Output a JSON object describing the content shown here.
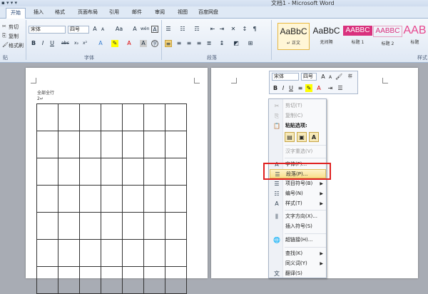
{
  "window": {
    "title": "文档1 - Microsoft Word",
    "qat": "▪ ▾ ▾ ▾"
  },
  "tabs": [
    "开始",
    "插入",
    "格式",
    "页面布局",
    "引用",
    "邮件",
    "审阅",
    "视图",
    "百度网盘"
  ],
  "clipboard": {
    "cut": "剪切",
    "copy": "复制",
    "format_painter": "格式刷",
    "group": "贴"
  },
  "font": {
    "name": "宋体",
    "size": "四号",
    "group": "字体",
    "grow": "A",
    "shrink": "A",
    "aa": "Aa",
    "clear": "A",
    "phonetic": "wén",
    "charbox": "A"
  },
  "paragraph": {
    "group": "段落"
  },
  "styles": [
    {
      "preview": "AaBbC",
      "label": "↵ 正文"
    },
    {
      "preview": "AaBbC",
      "label": "无间隔"
    },
    {
      "preview": "AABBC",
      "label": "标题 1"
    },
    {
      "preview": "AABBC",
      "label": "标题 2"
    },
    {
      "preview": "AAB",
      "label": "标题"
    }
  ],
  "styles_group": "样式",
  "document": {
    "first_line": "全部全行",
    "second_line": "2↵"
  },
  "mini_toolbar": {
    "font": "宋体",
    "size": "四号",
    "bold": "B",
    "italic": "I",
    "underline": "U",
    "grow": "A",
    "shrink": "A"
  },
  "context_menu": {
    "cut": "剪切(T)",
    "copy": "复制(C)",
    "paste_options": "粘贴选项:",
    "chinese_conversion": "汉字重选(V)",
    "font": "字体(F)...",
    "paragraph": "段落(P)...",
    "bullets": "项目符号(B)",
    "numbering": "编号(N)",
    "styles": "样式(T)",
    "text_direction": "文字方向(X)...",
    "insert_symbol": "插入符号(S)",
    "hyperlink": "超链接(H)...",
    "lookup": "查找(K)",
    "synonyms": "同义词(Y)",
    "translate": "翻译(S)"
  },
  "colors": {
    "highlight": "#f9df8c",
    "red_box": "#e02020",
    "tab_active_text": "#1b3d6e"
  }
}
